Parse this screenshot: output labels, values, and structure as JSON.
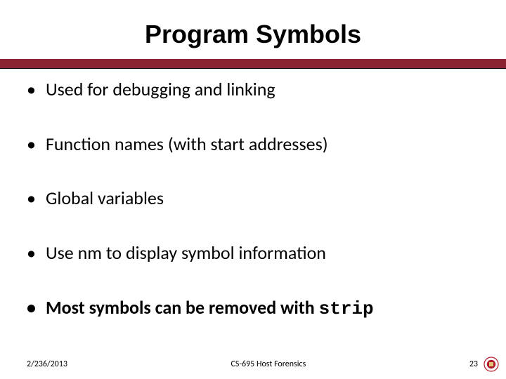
{
  "slide": {
    "title": "Program Symbols",
    "bullets": [
      {
        "text": "Used for debugging and linking",
        "style": "plain"
      },
      {
        "text": "Function names (with start addresses)",
        "style": "plain"
      },
      {
        "text": "Global variables",
        "style": "plain"
      },
      {
        "text": "Use nm to display symbol information",
        "style": "plain"
      },
      {
        "prefix": "Most symbols can be removed with ",
        "code": "strip",
        "style": "bold-with-code"
      }
    ],
    "bullet_glyph": "•"
  },
  "footer": {
    "date": "2/236/2013",
    "course": "CS-695 Host Forensics",
    "page_number": "23"
  },
  "colors": {
    "rule": "#8a2332",
    "logo_primary": "#b31b2c",
    "logo_accent": "#e0c77a"
  }
}
